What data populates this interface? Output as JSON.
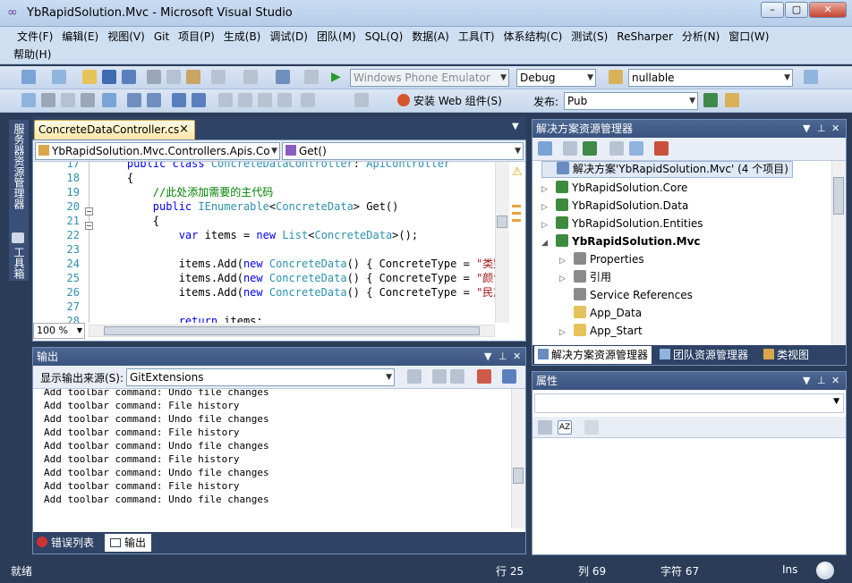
{
  "window": {
    "title": "YbRapidSolution.Mvc - Microsoft Visual Studio",
    "minimize": "–",
    "maximize": "▢",
    "close": "✕"
  },
  "menu": {
    "row1": [
      "文件(F)",
      "编辑(E)",
      "视图(V)",
      "Git",
      "项目(P)",
      "生成(B)",
      "调试(D)",
      "团队(M)",
      "SQL(Q)",
      "数据(A)",
      "工具(T)",
      "体系结构(C)",
      "测试(S)",
      "ReSharper",
      "分析(N)",
      "窗口(W)"
    ],
    "row2": [
      "帮助(H)"
    ]
  },
  "toolbar1": {
    "emulator": "Windows Phone Emulator",
    "config": "Debug",
    "search": "nullable"
  },
  "toolbar2": {
    "install_web": "安装 Web 组件(S)",
    "publish_label": "发布:",
    "publish_profile": "Pub"
  },
  "side_tabs": {
    "server": "服务器资源管理器",
    "toolbox": "工具箱"
  },
  "editor": {
    "tab": "ConcreteDataController.cs",
    "tab_close": "×",
    "nav_class": "YbRapidSolution.Mvc.Controllers.Apis.Co",
    "nav_member": "Get()",
    "zoom": "100 %",
    "lines": [
      {
        "n": "17",
        "parts": [
          [
            "",
            ""
          ],
          [
            "kw",
            "public class "
          ],
          [
            "ty",
            "ConcreteDataController"
          ],
          [
            "",
            ": "
          ],
          [
            "ty",
            "ApiController"
          ]
        ],
        "indent": "    "
      },
      {
        "n": "18",
        "parts": [
          [
            "",
            "{"
          ]
        ],
        "indent": "    "
      },
      {
        "n": "19",
        "parts": [
          [
            "cm",
            "//此处添加需要的主代码"
          ]
        ],
        "indent": "        "
      },
      {
        "n": "20",
        "parts": [
          [
            "kw",
            "public "
          ],
          [
            "ty",
            "IEnumerable"
          ],
          [
            "",
            "<"
          ],
          [
            "ty",
            "ConcreteData"
          ],
          [
            "",
            "> Get()"
          ]
        ],
        "indent": "        "
      },
      {
        "n": "21",
        "parts": [
          [
            "",
            "{"
          ]
        ],
        "indent": "        "
      },
      {
        "n": "22",
        "parts": [
          [
            "kw",
            "var"
          ],
          [
            "",
            " items = "
          ],
          [
            "kw",
            "new "
          ],
          [
            "ty",
            "List"
          ],
          [
            "",
            "<"
          ],
          [
            "ty",
            "ConcreteData"
          ],
          [
            "",
            ">();"
          ]
        ],
        "indent": "            "
      },
      {
        "n": "23",
        "parts": [
          [
            "",
            ""
          ]
        ],
        "indent": ""
      },
      {
        "n": "24",
        "parts": [
          [
            "",
            "items.Add("
          ],
          [
            "kw",
            "new "
          ],
          [
            "ty",
            "ConcreteData"
          ],
          [
            "",
            "() { ConcreteType = "
          ],
          [
            "st",
            "\"类别\""
          ]
        ],
        "indent": "            "
      },
      {
        "n": "25",
        "parts": [
          [
            "",
            "items.Add("
          ],
          [
            "kw",
            "new "
          ],
          [
            "ty",
            "ConcreteData"
          ],
          [
            "",
            "() { ConcreteType = "
          ],
          [
            "st",
            "\"颜色\""
          ]
        ],
        "indent": "            "
      },
      {
        "n": "26",
        "parts": [
          [
            "",
            "items.Add("
          ],
          [
            "kw",
            "new "
          ],
          [
            "ty",
            "ConcreteData"
          ],
          [
            "",
            "() { ConcreteType = "
          ],
          [
            "st",
            "\"民族\""
          ]
        ],
        "indent": "            "
      },
      {
        "n": "27",
        "parts": [
          [
            "",
            ""
          ]
        ],
        "indent": ""
      },
      {
        "n": "28",
        "parts": [
          [
            "kw",
            "return"
          ],
          [
            "",
            " items;"
          ]
        ],
        "indent": "            "
      }
    ]
  },
  "output": {
    "title": "输出",
    "source_label": "显示输出来源(S):",
    "source": "GitExtensions",
    "lines": [
      "Add toolbar command: Undo file changes",
      "Add toolbar command: File history",
      "Add toolbar command: Undo file changes",
      "Add toolbar command: File history",
      "Add toolbar command: Undo file changes",
      "Add toolbar command: File history",
      "Add toolbar command: Undo file changes",
      "Add toolbar command: File history",
      "Add toolbar command: Undo file changes"
    ],
    "tab_errors": "错误列表",
    "tab_output": "输出"
  },
  "solution": {
    "title": "解决方案资源管理器",
    "items": [
      {
        "label": "解决方案'YbRapidSolution.Mvc' (4 个项目)",
        "depth": 0,
        "exp": "",
        "color": "#6a8cc0",
        "selected": true
      },
      {
        "label": "YbRapidSolution.Core",
        "depth": 0,
        "exp": "▷",
        "color": "#3e8a3e"
      },
      {
        "label": "YbRapidSolution.Data",
        "depth": 0,
        "exp": "▷",
        "color": "#3e8a3e"
      },
      {
        "label": "YbRapidSolution.Entities",
        "depth": 0,
        "exp": "▷",
        "color": "#3e8a3e"
      },
      {
        "label": "YbRapidSolution.Mvc",
        "depth": 0,
        "exp": "◢",
        "color": "#3e8a3e",
        "bold": true
      },
      {
        "label": "Properties",
        "depth": 1,
        "exp": "▷",
        "color": "#8a8a8a"
      },
      {
        "label": "引用",
        "depth": 1,
        "exp": "▷",
        "color": "#8a8a8a"
      },
      {
        "label": "Service References",
        "depth": 1,
        "exp": "",
        "color": "#8a8a8a"
      },
      {
        "label": "App_Data",
        "depth": 1,
        "exp": "",
        "color": "#e6c25a"
      },
      {
        "label": "App_Start",
        "depth": 1,
        "exp": "▷",
        "color": "#e6c25a"
      }
    ],
    "tabs": [
      "解决方案资源管理器",
      "团队资源管理器",
      "类视图"
    ]
  },
  "properties": {
    "title": "属性"
  },
  "status": {
    "ready": "就绪",
    "row": "行 25",
    "col": "列 69",
    "char": "字符 67",
    "mode": "Ins"
  }
}
